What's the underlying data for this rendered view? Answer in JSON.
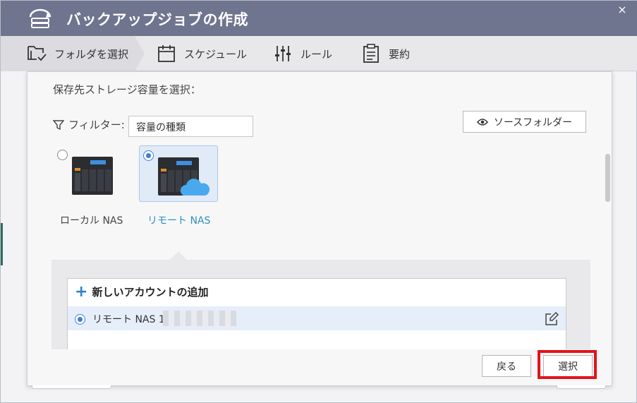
{
  "window": {
    "title": "バックアップジョブの作成",
    "close_label": "×"
  },
  "steps": [
    {
      "label": "フォルダを選択",
      "icon": "folder-check-icon",
      "active": true
    },
    {
      "label": "スケジュール",
      "icon": "calendar-icon",
      "active": false
    },
    {
      "label": "ルール",
      "icon": "sliders-icon",
      "active": false
    },
    {
      "label": "要約",
      "icon": "clipboard-icon",
      "active": false
    }
  ],
  "dialog": {
    "title": "保存先ストレージ容量を選択：",
    "filter_label": "フィルター:",
    "filter_value": "容量の種類",
    "source_button": "ソースフォルダー",
    "nas_options": [
      {
        "label": "ローカル NAS",
        "selected": false
      },
      {
        "label": "リモート NAS",
        "selected": true
      }
    ],
    "add_account": "新しいアカウントの追加",
    "accounts": [
      {
        "name": "リモート NAS 1",
        "selected": true
      }
    ],
    "back_button": "戻る",
    "select_button": "選択"
  },
  "colors": {
    "titlebar": "#6f748f",
    "accent": "#3d7ed8",
    "remote_label": "#2f8fbf",
    "highlight": "#e4121b"
  }
}
